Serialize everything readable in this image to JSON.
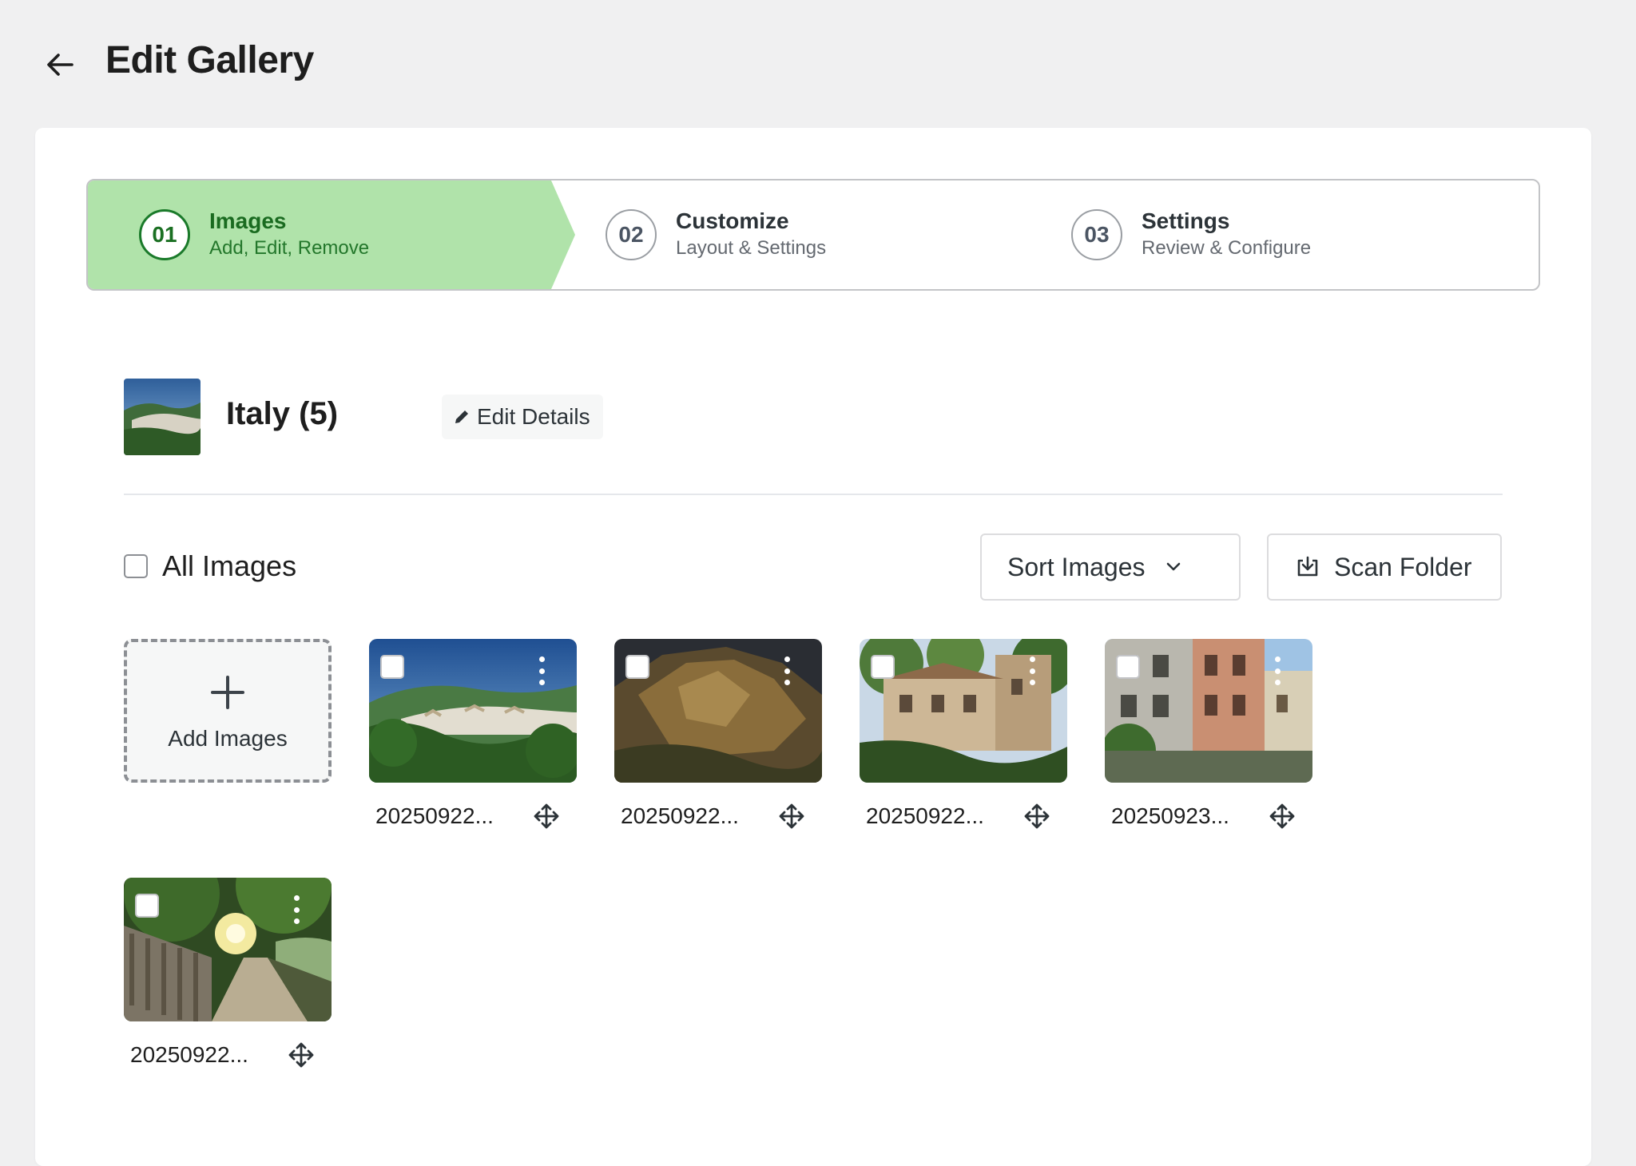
{
  "header": {
    "title": "Edit Gallery",
    "back_icon": "arrow-left-icon"
  },
  "stepper": {
    "active_color": "#b0e3aa",
    "steps": [
      {
        "number": "01",
        "title": "Images",
        "subtitle": "Add, Edit, Remove",
        "active": true
      },
      {
        "number": "02",
        "title": "Customize",
        "subtitle": "Layout & Settings",
        "active": false
      },
      {
        "number": "03",
        "title": "Settings",
        "subtitle": "Review & Configure",
        "active": false
      }
    ]
  },
  "gallery": {
    "name": "Italy (5)",
    "edit_details_label": "Edit Details",
    "edit_icon": "pencil-icon"
  },
  "toolbar": {
    "all_images_label": "All Images",
    "sort_label": "Sort Images",
    "sort_icon": "chevron-down-icon",
    "scan_label": "Scan Folder",
    "scan_icon": "download-box-icon"
  },
  "grid": {
    "add_label": "Add Images",
    "add_icon": "plus-icon",
    "images": [
      {
        "name": "20250922...",
        "scene": "hill-town"
      },
      {
        "name": "20250922...",
        "scene": "rock-formation"
      },
      {
        "name": "20250922...",
        "scene": "stone-villa"
      },
      {
        "name": "20250923...",
        "scene": "apartment-facade"
      },
      {
        "name": "20250922...",
        "scene": "forest-path"
      }
    ]
  }
}
